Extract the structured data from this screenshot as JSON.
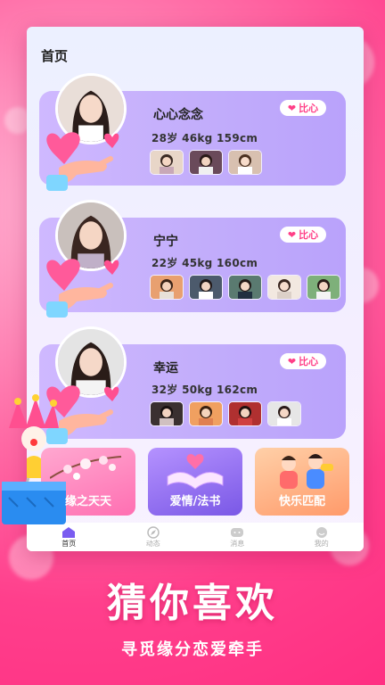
{
  "header": {
    "title": "首页"
  },
  "match_button_label": "比心",
  "profiles": [
    {
      "name": "心心念念",
      "stats": "28岁  46kg  159cm",
      "photo_count": 3
    },
    {
      "name": "宁宁",
      "stats": "22岁  45kg  160cm",
      "photo_count": 5
    },
    {
      "name": "幸运",
      "stats": "32岁  50kg  162cm",
      "photo_count": 4
    }
  ],
  "features": [
    {
      "label": "缘之天天",
      "color": "#ff76b8"
    },
    {
      "label": "爱情/法书",
      "color": "#8c6ef0"
    },
    {
      "label": "快乐匹配",
      "color": "#ffaf7a"
    }
  ],
  "tabbar": [
    {
      "label": "首页",
      "icon": "home-icon",
      "active": true
    },
    {
      "label": "动态",
      "icon": "compass-icon",
      "active": false
    },
    {
      "label": "消息",
      "icon": "message-icon",
      "active": false
    },
    {
      "label": "我的",
      "icon": "profile-icon",
      "active": false
    }
  ],
  "promo": {
    "title": "猜你喜欢",
    "subtitle": "寻觅缘分恋爱牵手"
  },
  "colors": {
    "accent": "#ff3f87",
    "card": "#c3aefb",
    "background": "#ff4f92"
  }
}
